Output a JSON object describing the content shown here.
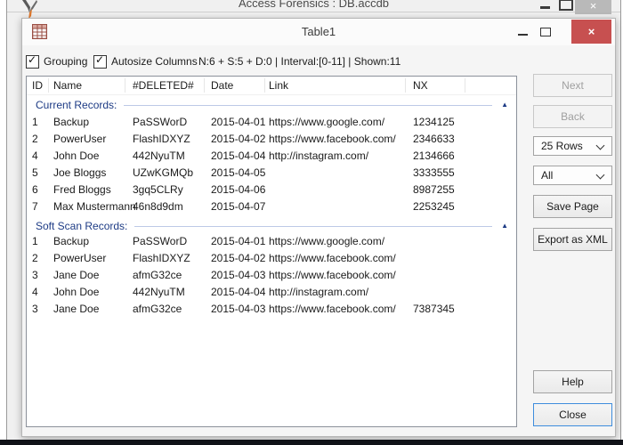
{
  "outer_window": {
    "title": "Access Forensics : DB.accdb"
  },
  "dialog": {
    "title": "Table1",
    "toolbar": {
      "grouping_label": "Grouping",
      "autosize_label": "Autosize Columns",
      "status": "N:6 + S:5 + D:0 | Interval:[0-11] | Shown:11"
    },
    "table": {
      "columns": [
        "ID",
        "Name",
        "#DELETED#",
        "Date",
        "Link",
        "NX"
      ],
      "groups": [
        {
          "label": "Current Records:",
          "rows": [
            [
              "1",
              "Backup",
              "PaSSWorD",
              "2015-04-01",
              "https://www.google.com/",
              "1234125"
            ],
            [
              "2",
              "PowerUser",
              "FlashIDXYZ",
              "2015-04-02",
              "https://www.facebook.com/",
              "2346633"
            ],
            [
              "4",
              "John Doe",
              "442NyuTM",
              "2015-04-04",
              "http://instagram.com/",
              "2134666"
            ],
            [
              "5",
              "Joe Bloggs",
              "UZwKGMQb",
              "2015-04-05",
              "",
              "3333555"
            ],
            [
              "6",
              "Fred Bloggs",
              "3gq5CLRy",
              "2015-04-06",
              "",
              "8987255"
            ],
            [
              "7",
              "Max Mustermann",
              "46n8d9dm",
              "2015-04-07",
              "",
              "2253245"
            ]
          ]
        },
        {
          "label": "Soft Scan Records:",
          "rows": [
            [
              "1",
              "Backup",
              "PaSSWorD",
              "2015-04-01",
              "https://www.google.com/",
              ""
            ],
            [
              "2",
              "PowerUser",
              "FlashIDXYZ",
              "2015-04-02",
              "https://www.facebook.com/",
              ""
            ],
            [
              "3",
              "Jane Doe",
              "afmG32ce",
              "2015-04-03",
              "https://www.facebook.com/",
              ""
            ],
            [
              "4",
              "John Doe",
              "442NyuTM",
              "2015-04-04",
              "http://instagram.com/",
              ""
            ],
            [
              "3",
              "Jane Doe",
              "afmG32ce",
              "2015-04-03",
              "https://www.facebook.com/",
              "7387345"
            ]
          ]
        }
      ]
    },
    "side_panel": {
      "next_label": "Next",
      "back_label": "Back",
      "rows_select_value": "25 Rows",
      "filter_select_value": "All",
      "save_page_label": "Save Page",
      "export_label": "Export as XML",
      "help_label": "Help",
      "close_label": "Close"
    }
  },
  "icons": {
    "close": "×",
    "check": "✓",
    "group_collapse": "▲"
  },
  "colors": {
    "close_button_bg": "#C75050",
    "group_header_text": "#1D3B85",
    "focused_button_border": "#3E8DDD",
    "bottom_strip": "#101218"
  }
}
